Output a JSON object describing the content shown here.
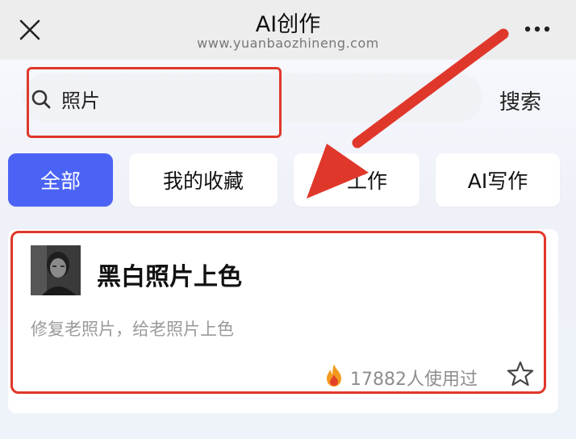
{
  "header": {
    "title": "AI创作",
    "subtitle": "www.yuanbaozhineng.com",
    "close_icon": "close-icon",
    "more_icon": "more-icon"
  },
  "search": {
    "value": "照片",
    "button_label": "搜索",
    "icon": "search-icon"
  },
  "tabs": [
    {
      "label": "全部",
      "active": true
    },
    {
      "label": "我的收藏",
      "active": false
    },
    {
      "label": "工作",
      "active": false
    },
    {
      "label": "AI写作",
      "active": false
    }
  ],
  "card": {
    "title": "黑白照片上色",
    "description": "修复老照片，给老照片上色",
    "usage": "17882人使用过",
    "usage_icon": "fire-icon",
    "favorite_icon": "star-icon"
  },
  "colors": {
    "accent": "#4a63f5",
    "highlight": "#e0372b"
  }
}
